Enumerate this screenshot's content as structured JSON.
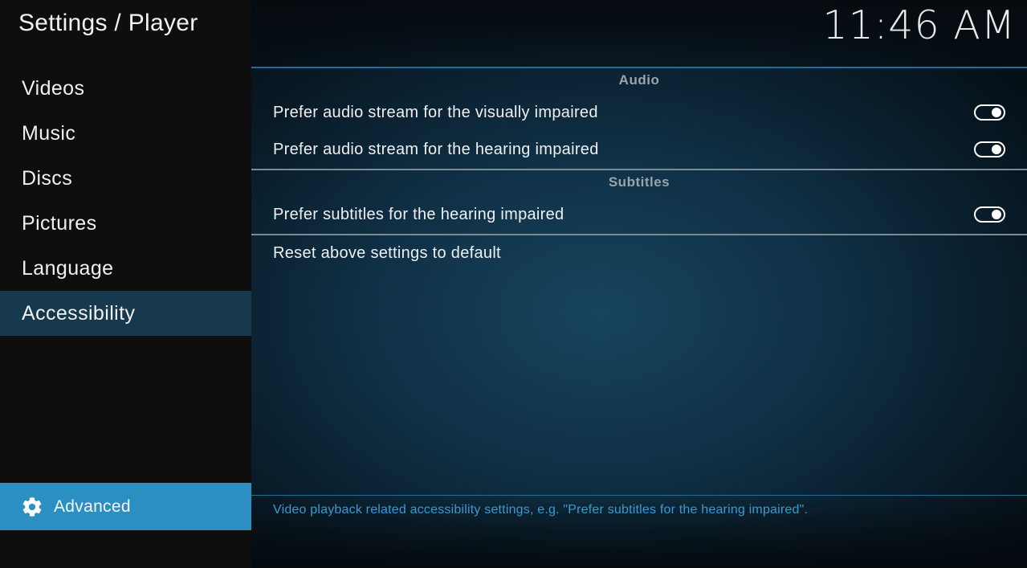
{
  "header": {
    "title": "Settings / Player",
    "clock": "11:46 AM"
  },
  "sidebar": {
    "items": [
      {
        "label": "Videos"
      },
      {
        "label": "Music"
      },
      {
        "label": "Discs"
      },
      {
        "label": "Pictures"
      },
      {
        "label": "Language"
      },
      {
        "label": "Accessibility",
        "selected": true
      }
    ],
    "level_button": {
      "icon": "gear-icon",
      "label": "Advanced"
    }
  },
  "main": {
    "sections": [
      {
        "title": "Audio",
        "settings": [
          {
            "label": "Prefer audio stream for the visually impaired",
            "control": "toggle",
            "value": true
          },
          {
            "label": "Prefer audio stream for the hearing impaired",
            "control": "toggle",
            "value": true
          }
        ]
      },
      {
        "title": "Subtitles",
        "settings": [
          {
            "label": "Prefer subtitles for the hearing impaired",
            "control": "toggle",
            "value": true
          }
        ]
      }
    ],
    "reset_label": "Reset above settings to default",
    "description": "Video playback related accessibility settings, e.g. \"Prefer subtitles for the hearing impaired\"."
  },
  "colors": {
    "accent": "#2c8fc2",
    "selected_item_bg": "#17394d",
    "description_text": "#3a9ad1",
    "section_header": "#9aa4aa"
  }
}
